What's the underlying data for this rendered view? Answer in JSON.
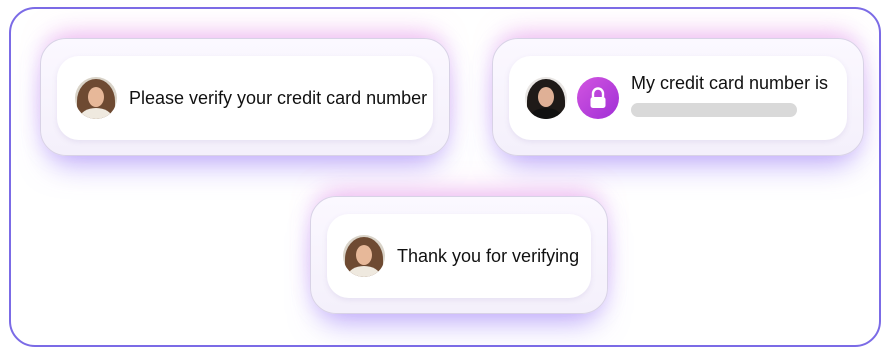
{
  "messages": [
    {
      "text": "Please verify your credit card number",
      "avatar": "woman-avatar"
    },
    {
      "text": "My credit card number is",
      "avatar": "woman-dark-hair-avatar",
      "badge": "lock-icon",
      "redacted": true
    },
    {
      "text": "Thank you for verifying",
      "avatar": "woman-avatar"
    }
  ],
  "colors": {
    "frame_border": "#7b6be6",
    "lock_badge": "#b83fd9",
    "redacted_bar": "#d9d9d9"
  }
}
